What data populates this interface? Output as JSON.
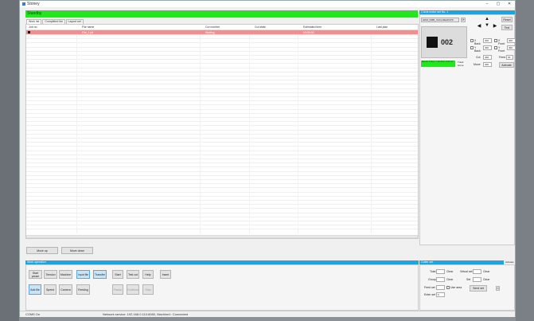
{
  "window": {
    "title": "Stoney",
    "controls": [
      "–",
      "▢",
      "✕"
    ]
  },
  "status_text": "Standby",
  "tabs": [
    {
      "label": "Work list",
      "active": true
    },
    {
      "label": "Completed list",
      "active": false
    },
    {
      "label": "Layout set",
      "active": false
    }
  ],
  "table": {
    "columns": [
      "Job no.",
      "File name",
      "Cut number",
      "Cut state",
      "Estimated time",
      "Last plan"
    ],
    "selected_row": [
      "",
      "File_1.plt",
      "",
      "Waiting",
      "00:00:00",
      ""
    ]
  },
  "move_buttons": {
    "up": "Move up",
    "down": "Move down"
  },
  "ops": {
    "title": "Work operation",
    "row1": [
      "Start pause",
      "Tension",
      "Machine",
      "Input file",
      "Transfer",
      "Start",
      "Test cut",
      "Help",
      "Insert"
    ],
    "row2": [
      "Add file",
      "Speed",
      "Camera",
      "Feeding",
      "Pause",
      "Continue",
      "Stop"
    ]
  },
  "machine": {
    "title": "2 Axis motor set No. 1",
    "device": "HDM_DMB_C101-DEAD37D",
    "refresh": "⟳",
    "display_value": "002",
    "reset": "Reset",
    "test": "Test",
    "coord_text": "Speed: X:30.2, Y: 52.25 Z: 3.00 m/s",
    "track_label": "Track",
    "track_label2": "home",
    "xy1": [
      {
        "label": "X Back",
        "value": "400"
      },
      {
        "label": "Y Back",
        "value": "400"
      }
    ],
    "xy2": [
      {
        "label": "X Front",
        "value": "400"
      },
      {
        "label": "Y Front",
        "value": "400"
      }
    ],
    "cut": {
      "label": "Cut",
      "value": "400"
    },
    "move": {
      "label": "Move",
      "value": "400"
    },
    "feed": {
      "label": "Feed",
      "value": "30"
    },
    "activate": "Activate"
  },
  "cutter": {
    "title": "Cutter set",
    "activate": "Activate",
    "fields": [
      {
        "label": "Total",
        "value": "",
        "action": "Clear"
      },
      {
        "label": "Group",
        "value": "",
        "action": "Clear"
      },
      {
        "label": "Feed set",
        "value": ""
      },
      {
        "label": "Enter set",
        "value": "0"
      }
    ],
    "fields2": [
      {
        "label": "Virtual set",
        "value": "",
        "action": "Clear"
      },
      {
        "label": "Set",
        "value": "",
        "action": "Clear"
      }
    ],
    "use_area": "Use area",
    "send": "Send set"
  },
  "statusbar": {
    "left": "COM5 On",
    "middle": "Network service: 192.168.0.110:6080, Machine1: Connected"
  }
}
